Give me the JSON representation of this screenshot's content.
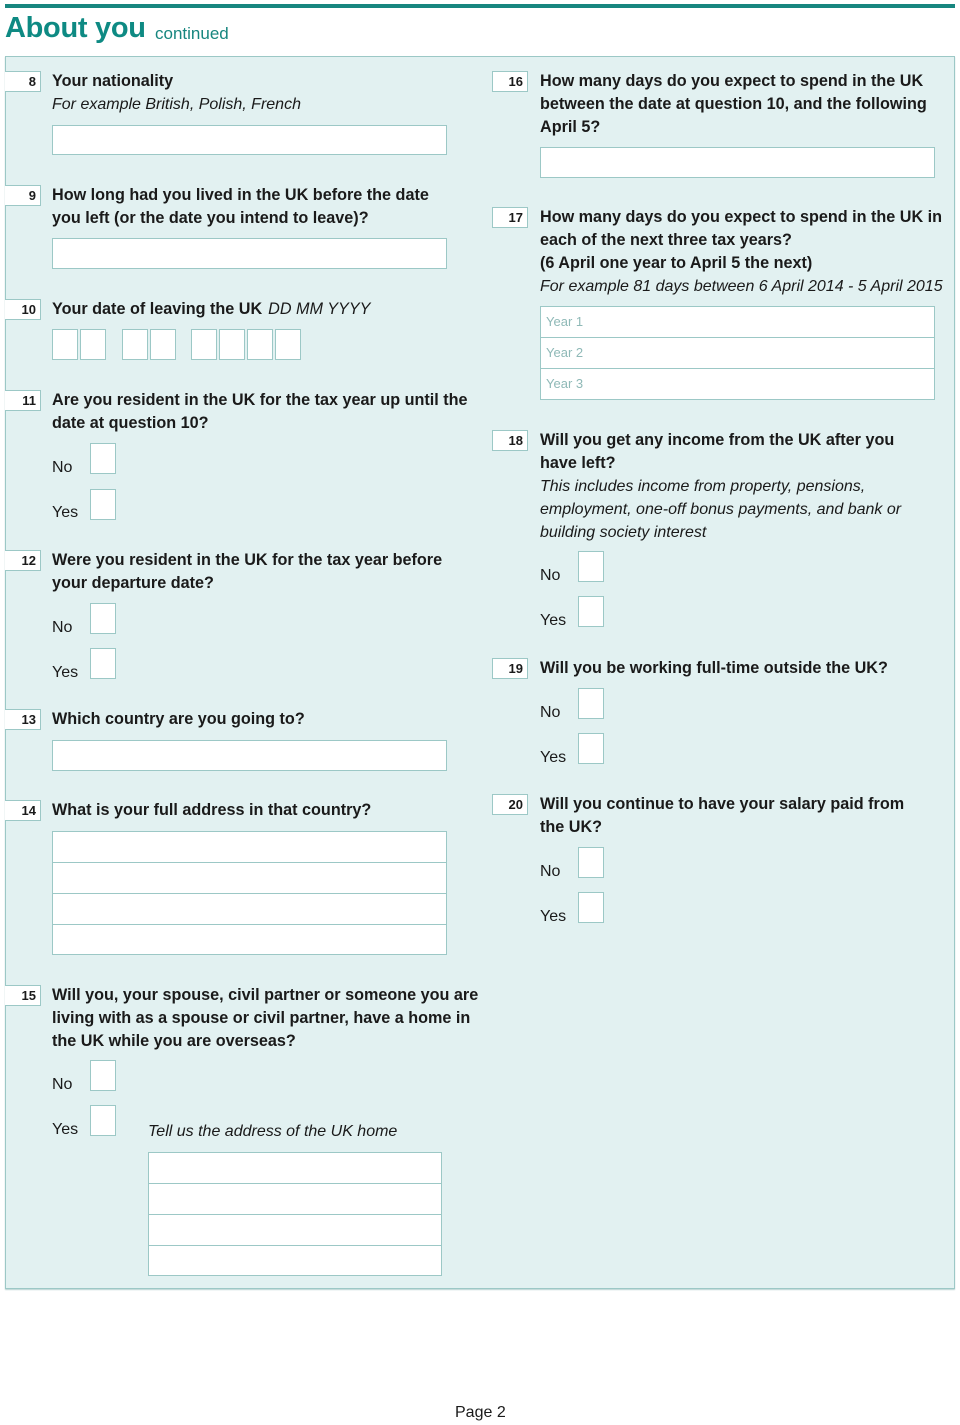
{
  "header": {
    "title": "About you",
    "subtitle": "continued"
  },
  "questions": {
    "q8": {
      "number": "8",
      "text": "Your nationality",
      "hint": "For example British, Polish, French"
    },
    "q9": {
      "number": "9",
      "text_lines": [
        "How long had you lived in the UK before the date",
        "you left (or the date you intend to leave)?"
      ]
    },
    "q10": {
      "number": "10",
      "text": "Your date of leaving the UK",
      "format_hint": "DD MM YYYY"
    },
    "q11": {
      "number": "11",
      "text_lines": [
        "Are you resident in the UK for the tax year up until the",
        "date at question 10?"
      ]
    },
    "q12": {
      "number": "12",
      "text_lines": [
        "Were you resident in the UK for the tax year before",
        "your departure date?"
      ]
    },
    "q13": {
      "number": "13",
      "text": "Which country are you going to?"
    },
    "q14": {
      "number": "14",
      "text": "What is your full address in that country?"
    },
    "q15": {
      "number": "15",
      "text_lines": [
        "Will you, your spouse, civil partner or someone you are",
        "living with as a spouse or civil partner, have a home in",
        "the UK while you are overseas?"
      ],
      "address_hint": "Tell us the address of the UK home"
    },
    "q16": {
      "number": "16",
      "text_lines": [
        "How many days do you expect to spend in the UK",
        "between the date at question 10, and the following",
        "April 5?"
      ]
    },
    "q17": {
      "number": "17",
      "text_lines": [
        "How many days do you expect to spend in the UK in",
        "each of the next three tax years?",
        "(6 April one year to April 5 the next)"
      ],
      "hint": "For example 81 days between 6 April 2014 - 5 April 2015",
      "year_labels": [
        "Year 1",
        "Year 2",
        "Year 3"
      ]
    },
    "q18": {
      "number": "18",
      "text_lines": [
        "Will you get any income from the UK after you",
        "have left?"
      ],
      "hint_lines": [
        "This includes income from property, pensions,",
        "employment, one-off bonus payments, and bank or",
        "building society interest"
      ]
    },
    "q19": {
      "number": "19",
      "text": "Will you be working full-time outside the UK?"
    },
    "q20": {
      "number": "20",
      "text_lines": [
        "Will you continue to have your salary paid from",
        "the UK?"
      ]
    }
  },
  "options": {
    "no": "No",
    "yes": "Yes"
  },
  "footer": {
    "page_label": "Page 2"
  },
  "colors": {
    "accent": "#17867f",
    "panel_bg": "#e2f1f1",
    "border": "#9cc8c6"
  }
}
